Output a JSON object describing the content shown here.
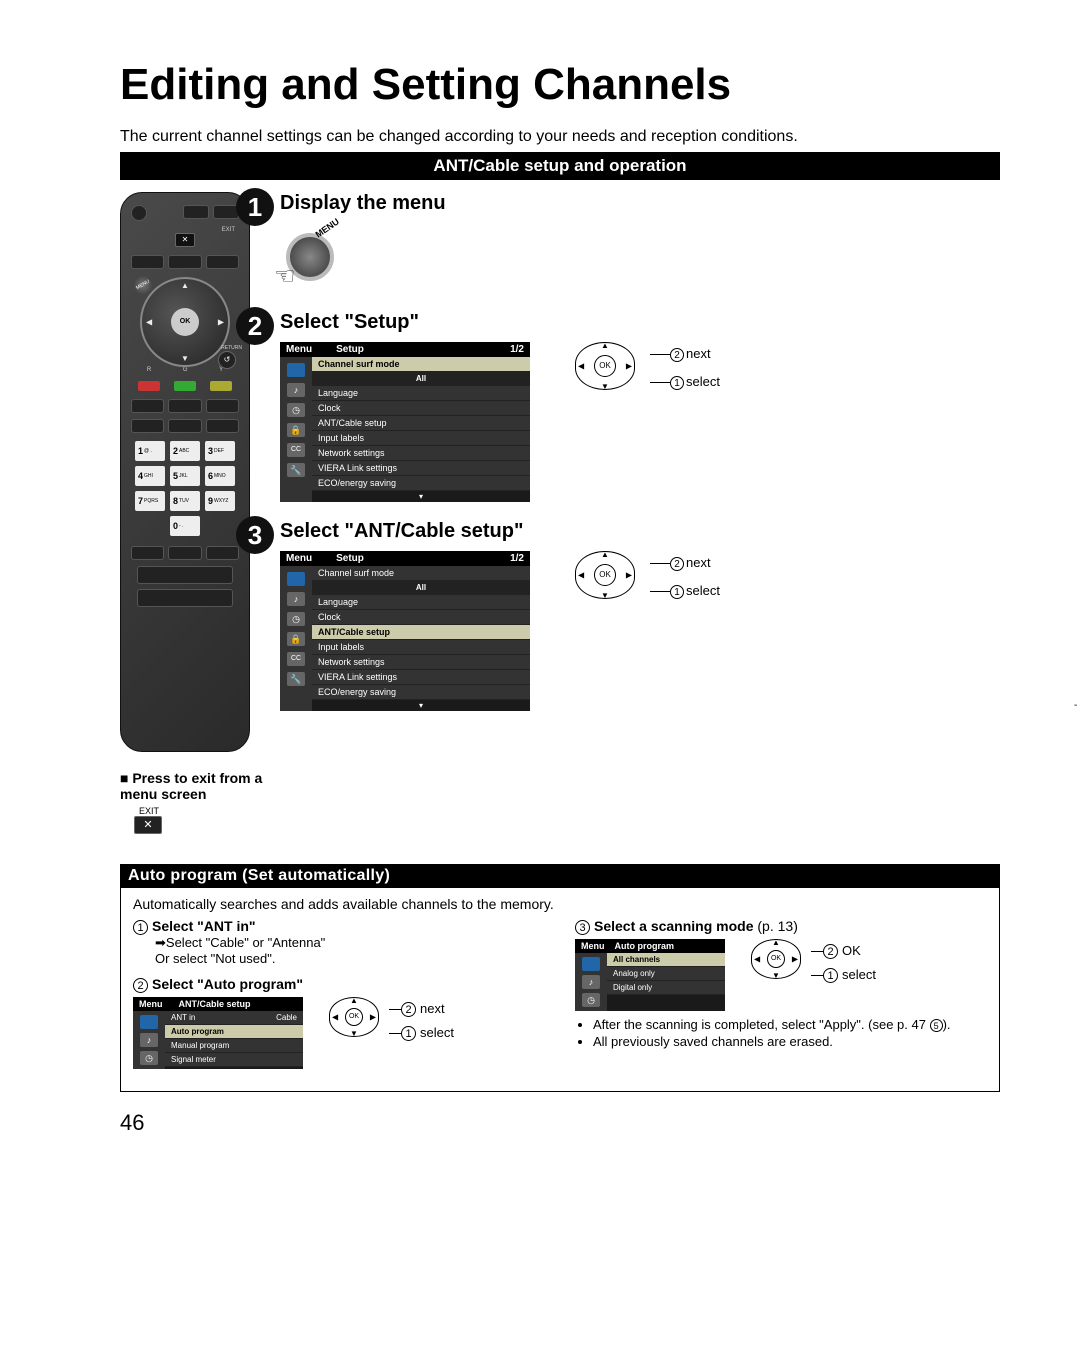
{
  "title": "Editing and Setting Channels",
  "intro": "The current channel settings can be changed according to your needs and reception conditions.",
  "bar1": "ANT/Cable setup and operation",
  "remote": {
    "exit_label": "EXIT",
    "ok": "OK",
    "menu_label": "MENU",
    "return_label": "RETURN",
    "color_r": "R",
    "color_g": "G",
    "color_y": "Y",
    "keys": [
      {
        "n": "1",
        "s": "@ ."
      },
      {
        "n": "2",
        "s": "ABC"
      },
      {
        "n": "3",
        "s": "DEF"
      },
      {
        "n": "4",
        "s": "GHI"
      },
      {
        "n": "5",
        "s": "JKL"
      },
      {
        "n": "6",
        "s": "MNO"
      },
      {
        "n": "7",
        "s": "PQRS"
      },
      {
        "n": "8",
        "s": "TUV"
      },
      {
        "n": "9",
        "s": "WXYZ"
      },
      {
        "n": "",
        "s": ""
      },
      {
        "n": "0",
        "s": "- ."
      },
      {
        "n": "",
        "s": ""
      }
    ],
    "x": "✕"
  },
  "step1": {
    "title": "Display the menu",
    "menu_btn": "MENU"
  },
  "step2": {
    "title": "Select \"Setup\"",
    "osd": {
      "menu": "Menu",
      "tab": "Setup",
      "page": "1/2",
      "items": [
        "Channel surf mode",
        "All",
        "Language",
        "Clock",
        "ANT/Cable setup",
        "Input labels",
        "Network settings",
        "VIERA Link settings",
        "ECO/energy saving"
      ],
      "selected": 0
    }
  },
  "step3": {
    "title": "Select \"ANT/Cable setup\"",
    "osd": {
      "menu": "Menu",
      "tab": "Setup",
      "page": "1/2",
      "items": [
        "Channel surf mode",
        "All",
        "Language",
        "Clock",
        "ANT/Cable setup",
        "Input labels",
        "Network settings",
        "VIERA Link settings",
        "ECO/energy saving"
      ],
      "selected": 4
    }
  },
  "nav": {
    "ok": "OK",
    "next": "next",
    "select": "select",
    "ok_label": "OK"
  },
  "exit_note": {
    "heading": "■ Press to exit from a menu screen",
    "label": "EXIT",
    "btn": "✕"
  },
  "bar2": "Auto program (Set automatically)",
  "auto": {
    "desc": "Automatically searches and adds available channels to the memory.",
    "s1": {
      "title": "Select \"ANT in\"",
      "l1": "Select \"Cable\" or \"Antenna\"",
      "l2": "Or select \"Not used\"."
    },
    "s2": {
      "title": "Select \"Auto program\"",
      "osd": {
        "menu": "Menu",
        "tab": "ANT/Cable setup",
        "items": [
          {
            "label": "ANT in",
            "val": "Cable",
            "sel": false
          },
          {
            "label": "Auto program",
            "val": "",
            "sel": true
          },
          {
            "label": "Manual program",
            "val": "",
            "sel": false
          },
          {
            "label": "Signal meter",
            "val": "",
            "sel": false
          }
        ]
      }
    },
    "s3": {
      "title_a": "Select a scanning mode",
      "title_b": "(p. 13)",
      "osd": {
        "menu": "Menu",
        "tab": "Auto program",
        "items": [
          {
            "label": "All channels",
            "sel": true
          },
          {
            "label": "Analog only",
            "sel": false
          },
          {
            "label": "Digital only",
            "sel": false
          }
        ]
      },
      "bullets": [
        "After the scanning is completed, select \"Apply\". (see p. 47 ⑤).",
        "All previously saved channels are erased."
      ]
    }
  },
  "page_num": "46"
}
